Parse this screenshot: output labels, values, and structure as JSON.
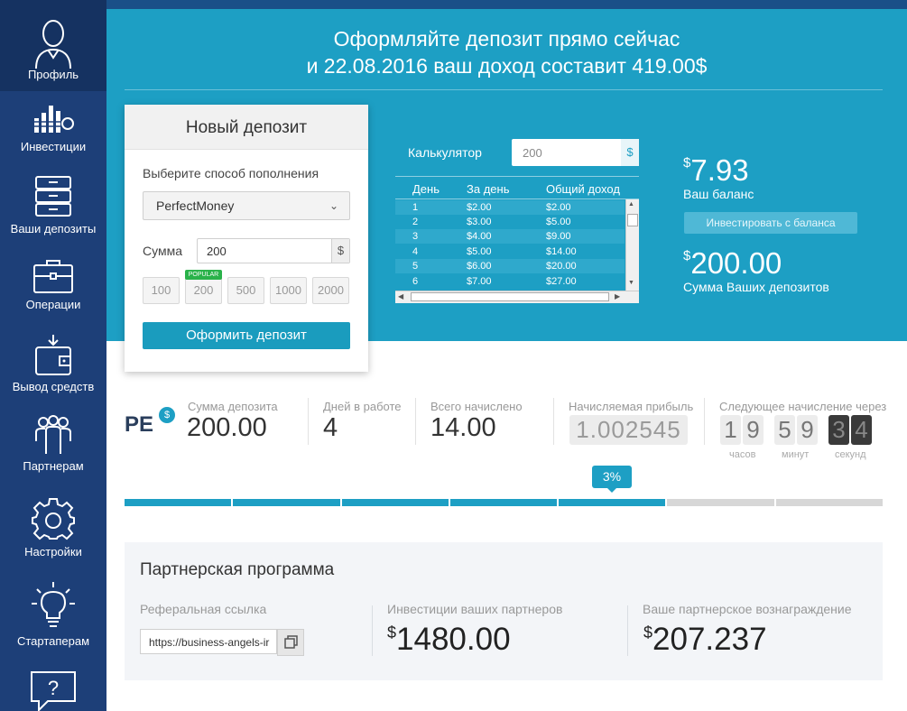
{
  "sidebar": {
    "items": [
      {
        "label": "Профиль",
        "icon": "profile-icon"
      },
      {
        "label": "Инвестиции",
        "icon": "investments-icon"
      },
      {
        "label": "Ваши депозиты",
        "icon": "deposits-icon"
      },
      {
        "label": "Операции",
        "icon": "briefcase-icon"
      },
      {
        "label": "Вывод средств",
        "icon": "wallet-icon"
      },
      {
        "label": "Партнерам",
        "icon": "partners-icon"
      },
      {
        "label": "Настройки",
        "icon": "gear-icon"
      },
      {
        "label": "Стартаперам",
        "icon": "lightbulb-icon"
      },
      {
        "label": "",
        "icon": "help-icon"
      }
    ]
  },
  "hero": {
    "line1": "Оформляйте депозит прямо сейчас",
    "line2": "и 22.08.2016 ваш доход составит 419.00$"
  },
  "deposit_card": {
    "title": "Новый депозит",
    "method_label": "Выберите способ пополнения",
    "method_value": "PerfectMoney",
    "sum_label": "Сумма",
    "sum_value": "200",
    "currency": "$",
    "amounts": [
      "100",
      "200",
      "500",
      "1000",
      "2000"
    ],
    "popular_badge": "POPULAR",
    "submit_label": "Оформить депозит"
  },
  "calculator": {
    "label": "Калькулятор",
    "value": "200",
    "currency": "$",
    "headers": [
      "День",
      "За день",
      "Общий доход"
    ],
    "rows": [
      [
        "1",
        "$2.00",
        "$2.00"
      ],
      [
        "2",
        "$3.00",
        "$5.00"
      ],
      [
        "3",
        "$4.00",
        "$9.00"
      ],
      [
        "4",
        "$5.00",
        "$14.00"
      ],
      [
        "5",
        "$6.00",
        "$20.00"
      ],
      [
        "6",
        "$7.00",
        "$27.00"
      ]
    ]
  },
  "balance": {
    "currency_symbol": "$",
    "balance_value": "7.93",
    "balance_label": "Ваш баланс",
    "invest_button": "Инвестировать с баланса",
    "deposits_value": "200.00",
    "deposits_label": "Сумма Ваших депозитов"
  },
  "stats": {
    "logo": "PE",
    "logo_badge": "$",
    "deposit_label": "Сумма депозита",
    "deposit_value": "200.00",
    "days_label": "Дней в работе",
    "days_value": "4",
    "accrued_label": "Всего начислено",
    "accrued_value": "14.00",
    "profit_label": "Начисляемая прибыль",
    "profit_value": "1.002545",
    "next_label": "Следующее начисление через",
    "hours": [
      "1",
      "9"
    ],
    "minutes": [
      "5",
      "9"
    ],
    "seconds": [
      "3",
      "4"
    ],
    "hours_label": "часов",
    "minutes_label": "минут",
    "seconds_label": "секунд"
  },
  "progress": {
    "percent_label": "3%",
    "filled_segments": 5,
    "total_segments": 7,
    "fill_color": "#1d9fc4",
    "empty_color": "#d7d7d7"
  },
  "partner": {
    "title": "Партнерская программа",
    "ref_label": "Реферальная ссылка",
    "ref_value": "https://business-angels-ir",
    "invest_label": "Инвестиции ваших партнеров",
    "invest_value": "1480.00",
    "reward_label": "Ваше партнерское вознаграждение",
    "reward_value": "207.237",
    "currency_symbol": "$"
  },
  "colors": {
    "sidebar": "#1d3f78",
    "hero": "#1d9fc4",
    "accent": "#1a9cbe",
    "popular": "#2ab24a"
  }
}
